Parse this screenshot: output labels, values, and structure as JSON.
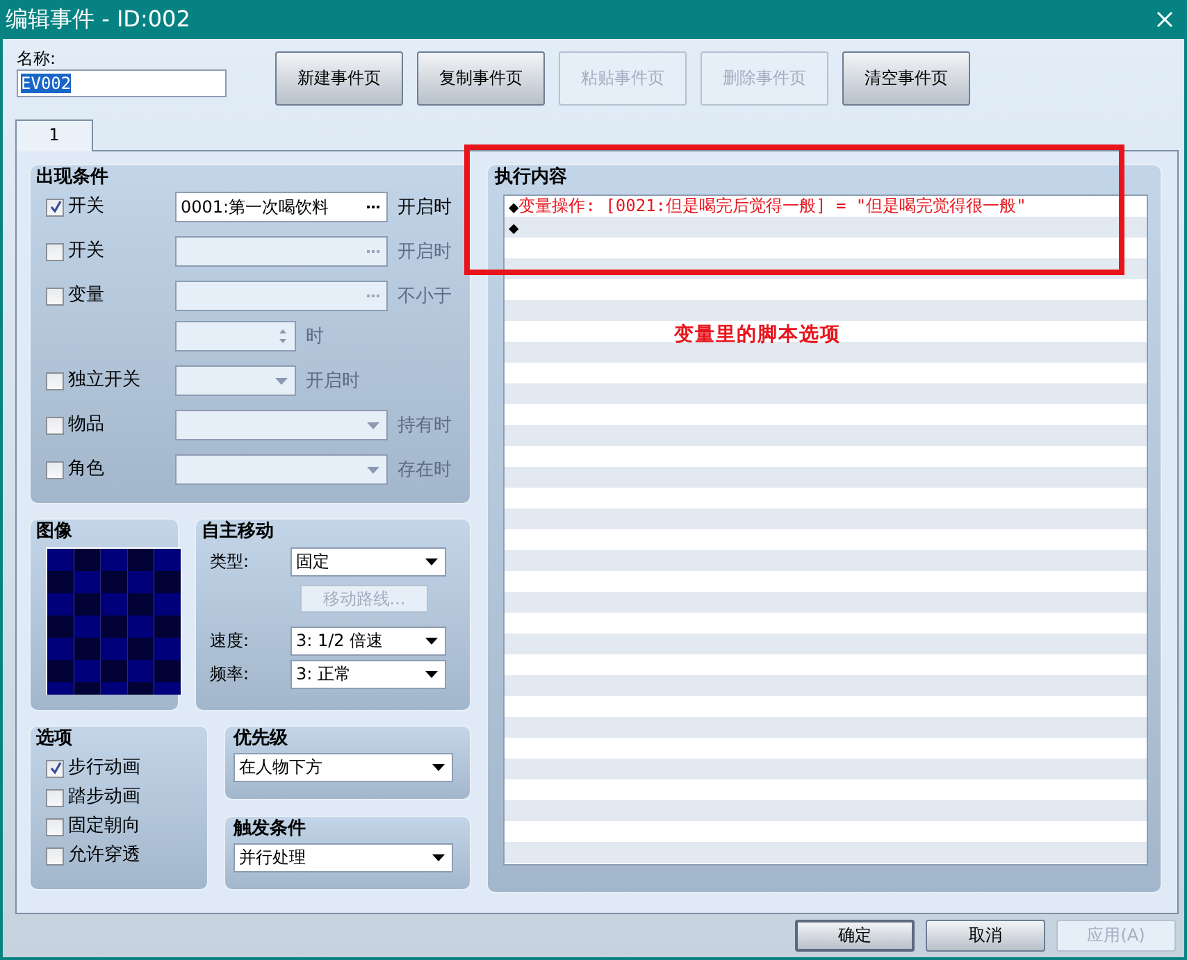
{
  "window": {
    "title": "编辑事件 - ID:002"
  },
  "name": {
    "label": "名称:",
    "value": "EV002"
  },
  "page_buttons": [
    {
      "label": "新建事件页",
      "disabled": false
    },
    {
      "label": "复制事件页",
      "disabled": false
    },
    {
      "label": "粘贴事件页",
      "disabled": true
    },
    {
      "label": "删除事件页",
      "disabled": true
    },
    {
      "label": "清空事件页",
      "disabled": false
    }
  ],
  "tabs": [
    {
      "label": "1",
      "selected": true
    }
  ],
  "conditions": {
    "title": "出现条件",
    "rows": [
      {
        "kind": "picker",
        "label": "开关",
        "checked": true,
        "disabled": false,
        "value": "0001:第一次喝饮料",
        "suffix": "开启时"
      },
      {
        "kind": "picker",
        "label": "开关",
        "checked": false,
        "disabled": true,
        "suffix": "开启时"
      },
      {
        "kind": "picker",
        "label": "变量",
        "checked": false,
        "disabled": true,
        "suffix": "不小于"
      },
      {
        "kind": "spin",
        "disabled": true,
        "suffix": "时"
      },
      {
        "kind": "short_select",
        "label": "独立开关",
        "checked": false,
        "disabled": true,
        "suffix": "开启时"
      },
      {
        "kind": "select",
        "label": "物品",
        "checked": false,
        "disabled": true,
        "suffix": "持有时"
      },
      {
        "kind": "select",
        "label": "角色",
        "checked": false,
        "disabled": true,
        "suffix": "存在时"
      }
    ]
  },
  "image": {
    "title": "图像"
  },
  "movement": {
    "title": "自主移动",
    "type_label": "类型:",
    "type": "固定",
    "route_button": {
      "label": "移动路线...",
      "disabled": true
    },
    "speed_label": "速度:",
    "speed": "3: 1/2 倍速",
    "freq_label": "频率:",
    "freq": "3: 正常"
  },
  "options": {
    "title": "选项",
    "items": [
      {
        "label": "步行动画",
        "checked": true
      },
      {
        "label": "踏步动画",
        "checked": false
      },
      {
        "label": "固定朝向",
        "checked": false
      },
      {
        "label": "允许穿透",
        "checked": false
      }
    ]
  },
  "priority": {
    "title": "优先级",
    "value": "在人物下方"
  },
  "trigger": {
    "title": "触发条件",
    "value": "并行处理"
  },
  "commands": {
    "title": "执行内容",
    "lines": [
      {
        "bullet": "◆",
        "text": "变量操作: [0021:但是喝完后觉得一般] = \"但是喝完觉得很一般\"",
        "color": "#e8141c"
      },
      {
        "bullet": "◆"
      }
    ]
  },
  "annotation": {
    "text": "变量里的脚本选项"
  },
  "footer_buttons": [
    {
      "label": "确定",
      "default": true,
      "disabled": false
    },
    {
      "label": "取消",
      "default": false,
      "disabled": false
    },
    {
      "label": "应用(A)",
      "default": false,
      "disabled": true
    }
  ]
}
